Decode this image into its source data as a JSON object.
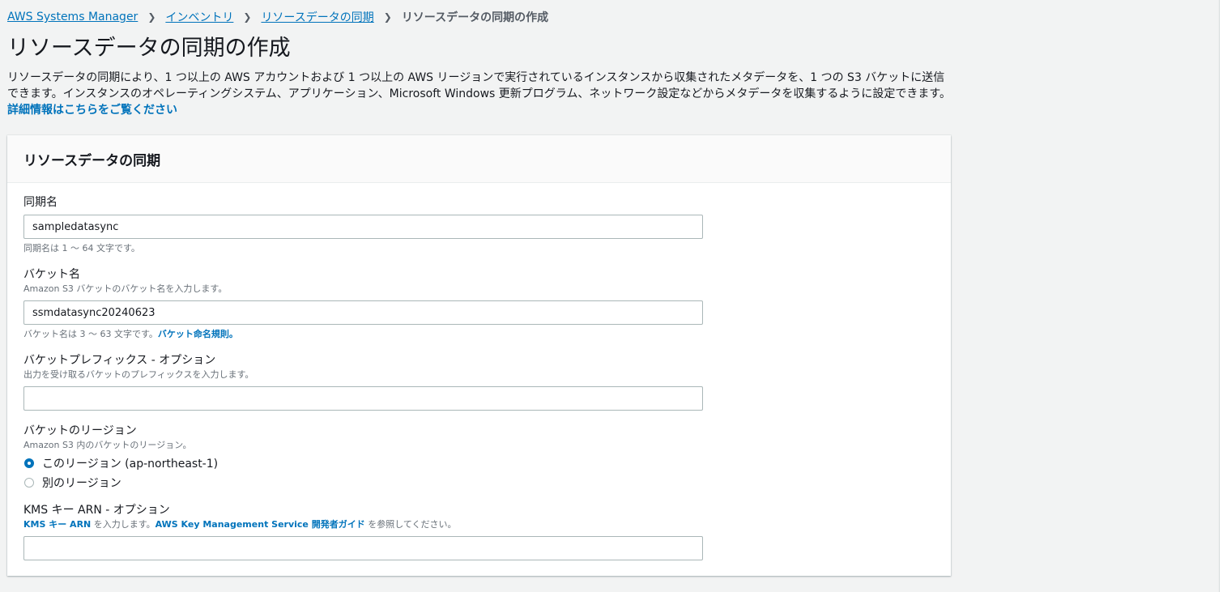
{
  "breadcrumb": {
    "items": [
      "AWS Systems Manager",
      "インベントリ",
      "リソースデータの同期"
    ],
    "current": "リソースデータの同期の作成"
  },
  "page": {
    "title": "リソースデータの同期の作成",
    "description": "リソースデータの同期により、1 つ以上の AWS アカウントおよび 1 つ以上の AWS リージョンで実行されているインスタンスから収集されたメタデータを、1 つの S3 バケットに送信できます。インスタンスのオペレーティングシステム、アプリケーション、Microsoft Windows 更新プログラム、ネットワーク設定などからメタデータを収集するように設定できます。",
    "learn_more": "詳細情報はこちらをご覧ください"
  },
  "panel": {
    "title": "リソースデータの同期",
    "sync_name": {
      "label": "同期名",
      "value": "sampledatasync",
      "constraint": "同期名は 1 ～ 64 文字です。"
    },
    "bucket_name": {
      "label": "バケット名",
      "description": "Amazon S3 バケットのバケット名を入力します。",
      "value": "ssmdatasync20240623",
      "constraint": "バケット名は 3 ～ 63 文字です。",
      "rules_link": "バケット命名規則。"
    },
    "bucket_prefix": {
      "label": "バケットプレフィックス - オプション",
      "description": "出力を受け取るバケットのプレフィックスを入力します。",
      "value": ""
    },
    "bucket_region": {
      "label": "バケットのリージョン",
      "description": "Amazon S3 内のバケットのリージョン。",
      "options": [
        {
          "label": "このリージョン (ap-northeast-1)",
          "checked": true
        },
        {
          "label": "別のリージョン",
          "checked": false
        }
      ]
    },
    "kms_key": {
      "label": "KMS キー ARN - オプション",
      "desc_link1": "KMS キー ARN",
      "desc_text1": " を入力します。",
      "desc_link2": "AWS Key Management Service 開発者ガイド",
      "desc_text2": " を参照してください。",
      "value": ""
    }
  },
  "colors": {
    "link": "#0073bb",
    "background": "#f2f3f3",
    "panel_header": "#fafafa"
  }
}
